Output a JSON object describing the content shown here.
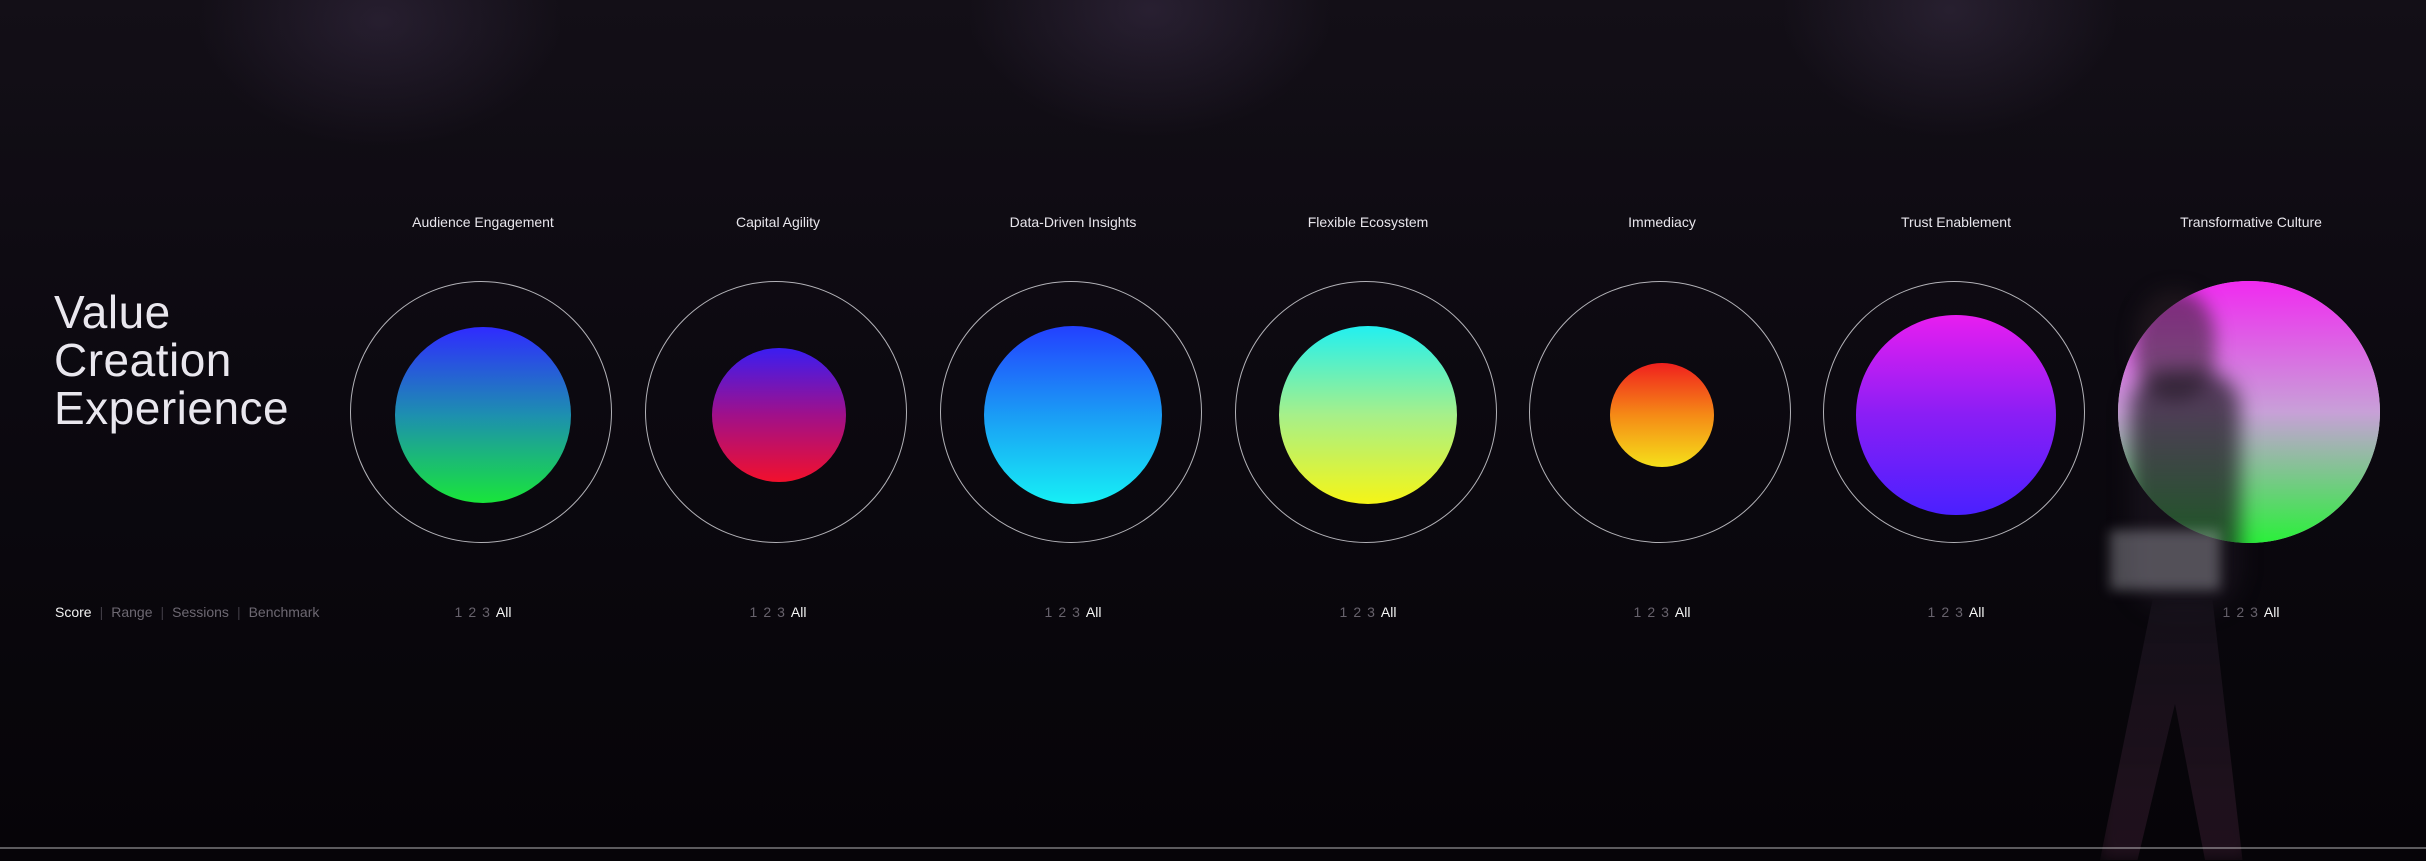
{
  "title_lines": [
    "Value",
    "Creation",
    "Experience"
  ],
  "view_modes": [
    {
      "label": "Score",
      "active": true
    },
    {
      "label": "Range",
      "active": false
    },
    {
      "label": "Sessions",
      "active": false
    },
    {
      "label": "Benchmark",
      "active": false
    }
  ],
  "session_options": [
    "1",
    "2",
    "3",
    "All"
  ],
  "metrics": [
    {
      "label": "Audience Engagement",
      "colors": [
        "#2f2bff",
        "#1d8fb0",
        "#19e53a"
      ]
    },
    {
      "label": "Capital Agility",
      "colors": [
        "#3a1df2",
        "#a0108a",
        "#f2102c"
      ]
    },
    {
      "label": "Data-Driven Insights",
      "colors": [
        "#2340ff",
        "#1a9cf5",
        "#16f0f5"
      ]
    },
    {
      "label": "Flexible Ecosystem",
      "colors": [
        "#22f0f0",
        "#a6f08a",
        "#f5f516"
      ]
    },
    {
      "label": "Immediacy",
      "colors": [
        "#f0201e",
        "#f58a16",
        "#f5e01a"
      ]
    },
    {
      "label": "Trust Enablement",
      "colors": [
        "#e81ef0",
        "#8a1ef5",
        "#4a20ff"
      ]
    },
    {
      "label": "Transformative Culture",
      "colors": [
        "#f02af0",
        "#c8a0d8",
        "#2af03a"
      ]
    }
  ]
}
